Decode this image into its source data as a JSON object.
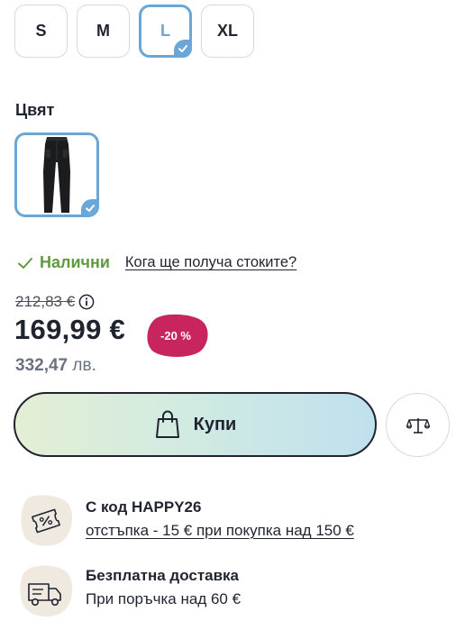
{
  "sizes": {
    "options": [
      "S",
      "M",
      "L",
      "XL"
    ],
    "selected": "L"
  },
  "color": {
    "title": "Цвят",
    "swatch_icon": "black-pants-thumbnail"
  },
  "stock": {
    "status": "Налични",
    "delivery_link": "Кога ще получа стоките?"
  },
  "price": {
    "old": "212,83 €",
    "current": "169,99 €",
    "discount": "-20 %",
    "lev_value": "332,47",
    "lev_unit": "лв."
  },
  "actions": {
    "buy_label": "Купи",
    "buy_icon": "shopping-bag-icon",
    "compare_icon": "scales-icon"
  },
  "promos": [
    {
      "icon": "ticket-percent-icon",
      "title": "С код HAPPY26",
      "subtitle": "отстъпка - 15 € при покупка над 150 €"
    },
    {
      "icon": "delivery-truck-icon",
      "title": "Безплатна доставка",
      "subtitle": "При поръчка над 60 €"
    }
  ],
  "colors": {
    "accent_blue": "#6aa6d6",
    "in_stock_green": "#5f9a3f",
    "discount_red": "#c8245e"
  }
}
